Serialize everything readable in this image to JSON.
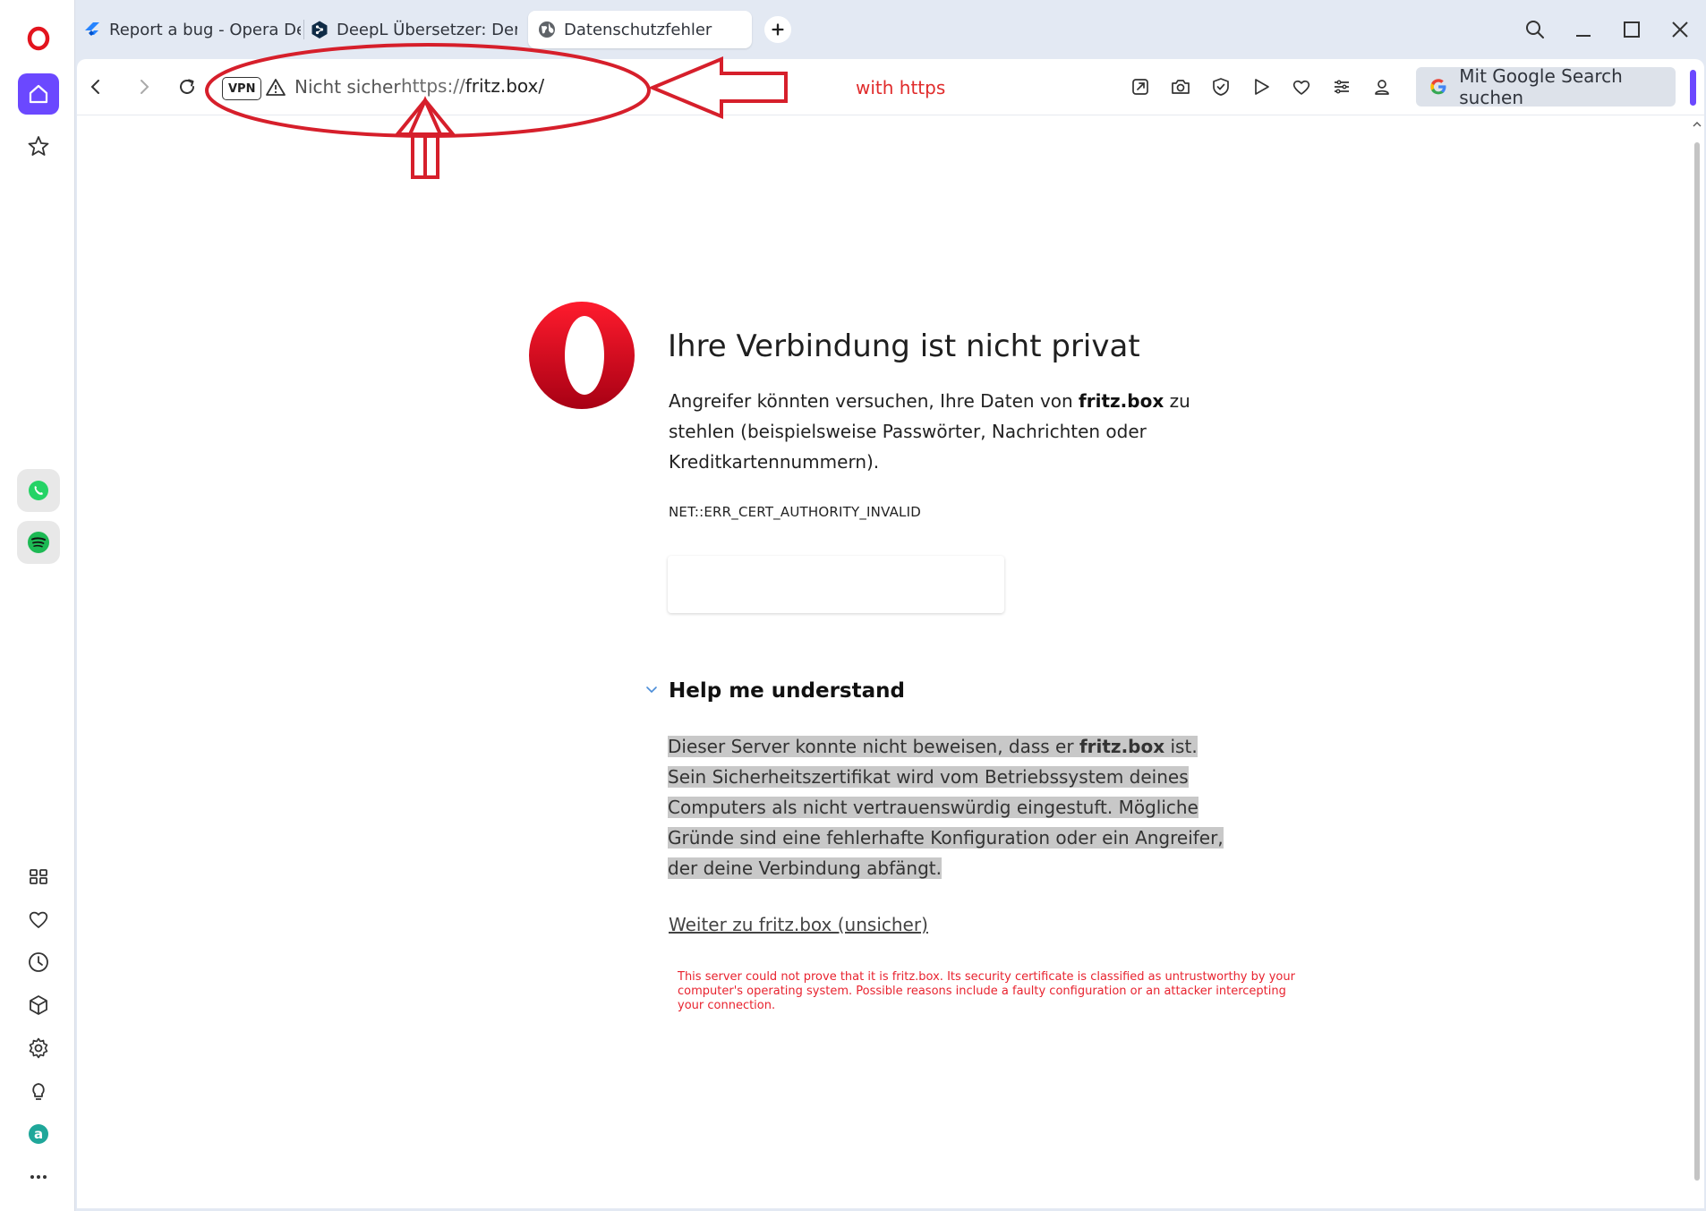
{
  "tabs": [
    {
      "title": "Report a bug - Opera Desk",
      "icon": "jira-icon"
    },
    {
      "title": "DeepL Übersetzer: Der präz",
      "icon": "deepl-icon"
    },
    {
      "title": "Datenschutzfehler",
      "icon": "globe-icon",
      "active": true
    }
  ],
  "address_bar": {
    "vpn_label": "VPN",
    "security_label": "Nicht sicher",
    "url_scheme": "https://",
    "url_host": "fritz.box/",
    "search_label": "Mit Google Search suchen"
  },
  "toolbar_icons": [
    "share-icon",
    "camera-icon",
    "shield-icon",
    "play-icon",
    "heart-icon",
    "easy-setup-icon",
    "profile-icon"
  ],
  "sidebar_icons": [
    "opera-icon",
    "home-icon",
    "star-icon",
    "whatsapp-icon",
    "spotify-icon",
    "apps-icon",
    "heart-icon",
    "history-icon",
    "extensions-icon",
    "settings-icon",
    "lightbulb-icon",
    "aria-icon",
    "more-icon"
  ],
  "error_page": {
    "title": "Ihre Verbindung ist nicht privat",
    "desc_part1": "Angreifer könnten versuchen, Ihre Daten von ",
    "desc_host": "fritz.box",
    "desc_part2": " zu stehlen (beispielsweise Passwörter, Nachrichten oder Kreditkartennummern).",
    "error_code": "NET::ERR_CERT_AUTHORITY_INVALID",
    "help_title": "Help me understand",
    "help_part1": "Dieser Server konnte nicht beweisen, dass er ",
    "help_host": "fritz.box",
    "help_part2": " ist. Sein Sicherheitszertifikat wird vom Betriebssystem deines Computers als nicht vertrauenswürdig eingestuft. Mögliche Gründe sind eine fehlerhafte Konfiguration oder ein Angreifer, der deine Verbindung abfängt.",
    "proceed_link": "Weiter zu fritz.box (unsicher)"
  },
  "annotation": {
    "label": "with https",
    "note": "This server could not prove that it is fritz.box. Its security certificate is classified as untrustworthy by your computer's operating system. Possible reasons include a faulty configuration or an attacker intercepting your connection.",
    "color": "#e02b2b"
  },
  "colors": {
    "accent": "#6b48ff",
    "opera_red": "#e3141e",
    "chrome_bg": "#e3e9f3"
  }
}
